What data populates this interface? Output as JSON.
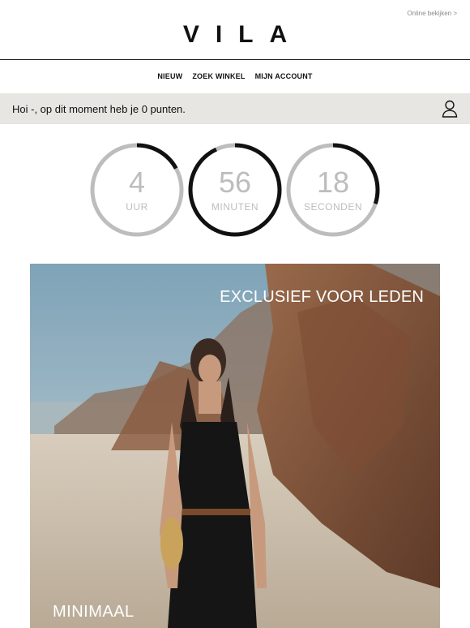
{
  "header": {
    "online_link": "Online bekijken >",
    "logo": "VILA"
  },
  "nav": {
    "items": [
      {
        "label": "NIEUW"
      },
      {
        "label": "ZOEK WINKEL"
      },
      {
        "label": "MIJN ACCOUNT"
      }
    ]
  },
  "greeting": {
    "text": "Hoi -, op dit moment heb je 0 punten.",
    "icon": "user-icon"
  },
  "countdown": [
    {
      "value": "4",
      "label": "UUR",
      "progress": 0.17
    },
    {
      "value": "56",
      "label": "MINUTEN",
      "progress": 0.93
    },
    {
      "value": "18",
      "label": "SECONDEN",
      "progress": 0.3
    }
  ],
  "hero": {
    "title": "EXCLUSIEF VOOR LEDEN",
    "subtitle": "MINIMAAL"
  },
  "colors": {
    "accent": "#111111",
    "track": "#bdbdbd",
    "banner": "#e8e6e2"
  }
}
